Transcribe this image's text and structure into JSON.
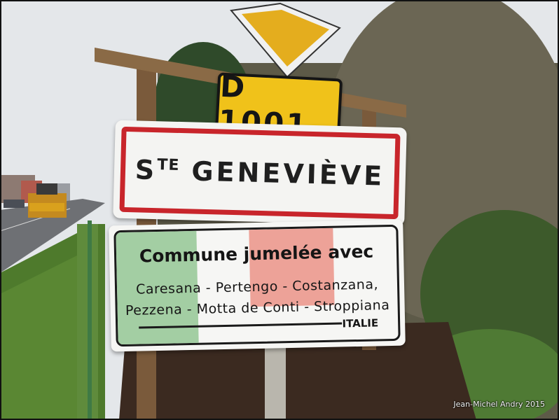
{
  "photo": {
    "route_number": "D 1001",
    "town_sign": {
      "prefix": "S",
      "prefix_superscript": "TE",
      "name": "GENEVIÈVE"
    },
    "twin_sign": {
      "title": "Commune jumelée avec",
      "line1": "Caresana - Pertengo - Costanzana,",
      "line2": "Pezzena - Motta de Conti - Stroppiana",
      "country": "ITALIE"
    },
    "credit": "Jean-Michel Andry 2015"
  },
  "colors": {
    "route_plate_yellow": "#f0c21a",
    "town_sign_red": "#c8252b",
    "flag_green": "#8ec48f",
    "flag_red": "#e98579",
    "grass": "#4e7a2c",
    "sky": "#e6e9ec"
  }
}
